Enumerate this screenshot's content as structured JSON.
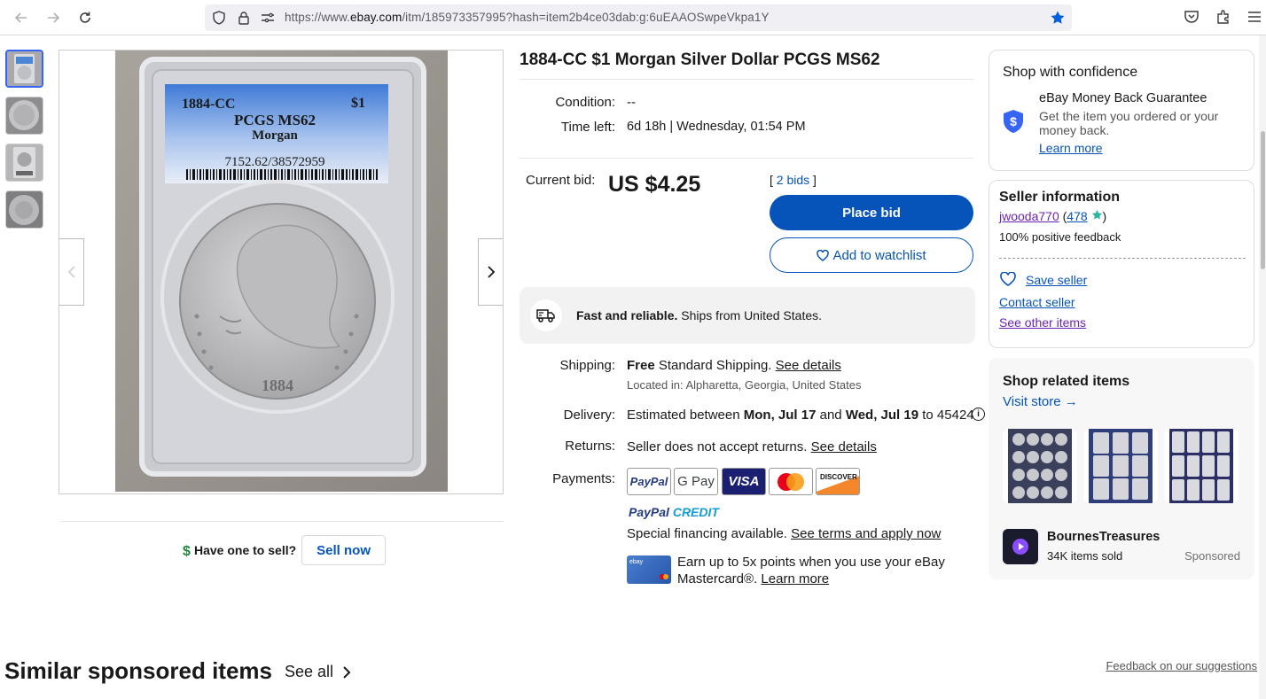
{
  "browser": {
    "url_prefix": "https://www.",
    "url_host": "ebay.com",
    "url_path": "/itm/185973357995?hash=item2b4ce03dab:g:6uEAAOSwpeVkpa1Y"
  },
  "gallery": {
    "slab_label": {
      "year": "1884-CC",
      "denomination": "$1",
      "grade": "PCGS MS62",
      "type": "Morgan",
      "cert": "7152.62/38572959"
    },
    "coin_year": "1884"
  },
  "sell": {
    "question": "Have one to sell?",
    "button": "Sell now"
  },
  "similar": {
    "title": "Similar sponsored items",
    "see_all": "See all",
    "feedback": "Feedback on our suggestions"
  },
  "item": {
    "title": "1884-CC $1 Morgan Silver Dollar PCGS MS62",
    "condition_label": "Condition:",
    "condition_value": "--",
    "time_left_label": "Time left:",
    "time_left_value": "6d 18h | Wednesday, 01:54 PM",
    "current_bid_label": "Current bid:",
    "current_bid_value": "US $4.25",
    "bids_open": "[",
    "bids_link": "2 bids",
    "bids_close": "]",
    "place_bid": "Place bid",
    "add_watchlist": "Add to watchlist",
    "banner_bold": "Fast and reliable.",
    "banner_text": "Ships from United States.",
    "shipping_label": "Shipping:",
    "shipping_free": "Free",
    "shipping_text": "Standard Shipping.",
    "shipping_link": "See details",
    "located": "Located in: Alpharetta, Georgia, United States",
    "delivery_label": "Delivery:",
    "delivery_pre": "Estimated between",
    "delivery_date1": "Mon, Jul 17",
    "delivery_and": "and",
    "delivery_date2": "Wed, Jul 19",
    "delivery_post": "to 45424",
    "returns_label": "Returns:",
    "returns_text": "Seller does not accept returns.",
    "returns_link": "See details",
    "payments_label": "Payments:",
    "payment_logos": [
      "PayPal",
      "G Pay",
      "VISA",
      "",
      "DISCOVER"
    ],
    "ppcredit_a": "PayPal",
    "ppcredit_b": "CREDIT",
    "financing_text": "Special financing available.",
    "financing_link": "See terms and apply now",
    "card_line1": "Earn up to 5x points when you use your eBay",
    "card_line2": "Mastercard®.",
    "card_link": "Learn more"
  },
  "confidence": {
    "title": "Shop with confidence",
    "guarantee_title": "eBay Money Back Guarantee",
    "guarantee_line1": "Get the item you ordered or your",
    "guarantee_line2": "money back.",
    "learn_more": "Learn more"
  },
  "seller": {
    "title": "Seller information",
    "name": "jwooda770",
    "score_open": "(",
    "score": "478",
    "score_close": ")",
    "feedback": "100% positive feedback",
    "save": "Save seller",
    "contact": "Contact seller",
    "other_items": "See other items"
  },
  "related": {
    "title": "Shop related items",
    "visit": "Visit store",
    "store_name": "BournesTreasures",
    "store_items": "34K items sold",
    "sponsored": "Sponsored"
  },
  "colors": {
    "ebay_blue": "#0654ba",
    "link_purple": "#6b24b2",
    "firefox_blue": "#0060df"
  }
}
